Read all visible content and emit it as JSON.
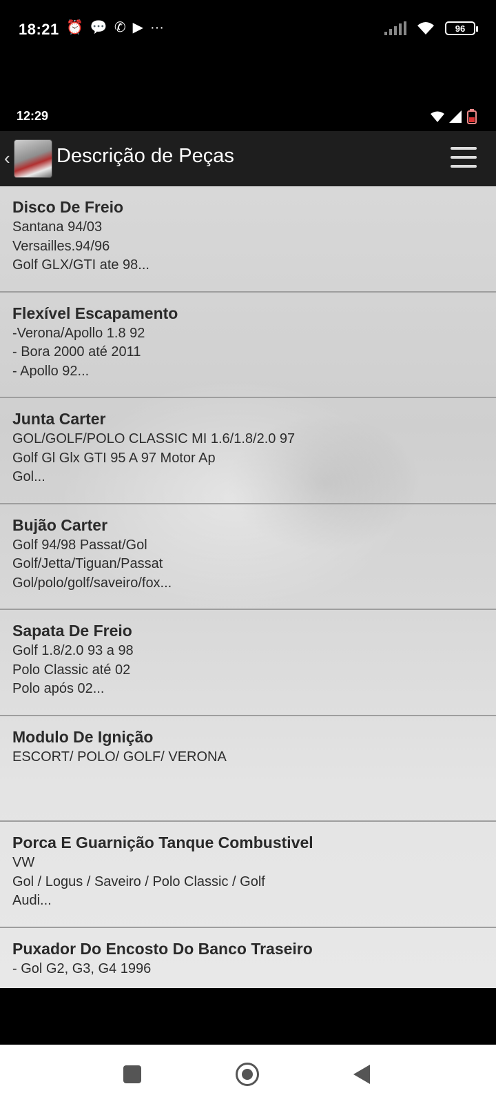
{
  "outer_status": {
    "time": "18:21",
    "battery": "96"
  },
  "inner_status": {
    "time": "12:29"
  },
  "appbar": {
    "title": "Descrição de Peças"
  },
  "items": [
    {
      "title": "Disco De Freio",
      "desc": "Santana 94/03\nVersailles.94/96\nGolf GLX/GTI ate 98..."
    },
    {
      "title": "Flexível Escapamento",
      "desc": "-Verona/Apollo 1.8 92\n- Bora 2000 até 2011\n- Apollo 92..."
    },
    {
      "title": "Junta Carter",
      "desc": "GOL/GOLF/POLO CLASSIC MI 1.6/1.8/2.0 97\nGolf Gl Glx GTI 95 A 97 Motor Ap\nGol..."
    },
    {
      "title": "Bujão Carter",
      "desc": "Golf 94/98 Passat/Gol\nGolf/Jetta/Tiguan/Passat\nGol/polo/golf/saveiro/fox..."
    },
    {
      "title": "Sapata De Freio",
      "desc": "Golf 1.8/2.0 93 a 98\nPolo Classic até 02\nPolo após 02..."
    },
    {
      "title": "Modulo De Ignição",
      "desc": "ESCORT/ POLO/ GOLF/ VERONA"
    },
    {
      "title": "Porca E Guarnição Tanque Combustivel",
      "desc": "VW\nGol / Logus / Saveiro / Polo Classic / Golf\nAudi..."
    },
    {
      "title": "Puxador Do Encosto Do Banco Traseiro",
      "desc": "- Gol G2, G3, G4 1996"
    }
  ]
}
